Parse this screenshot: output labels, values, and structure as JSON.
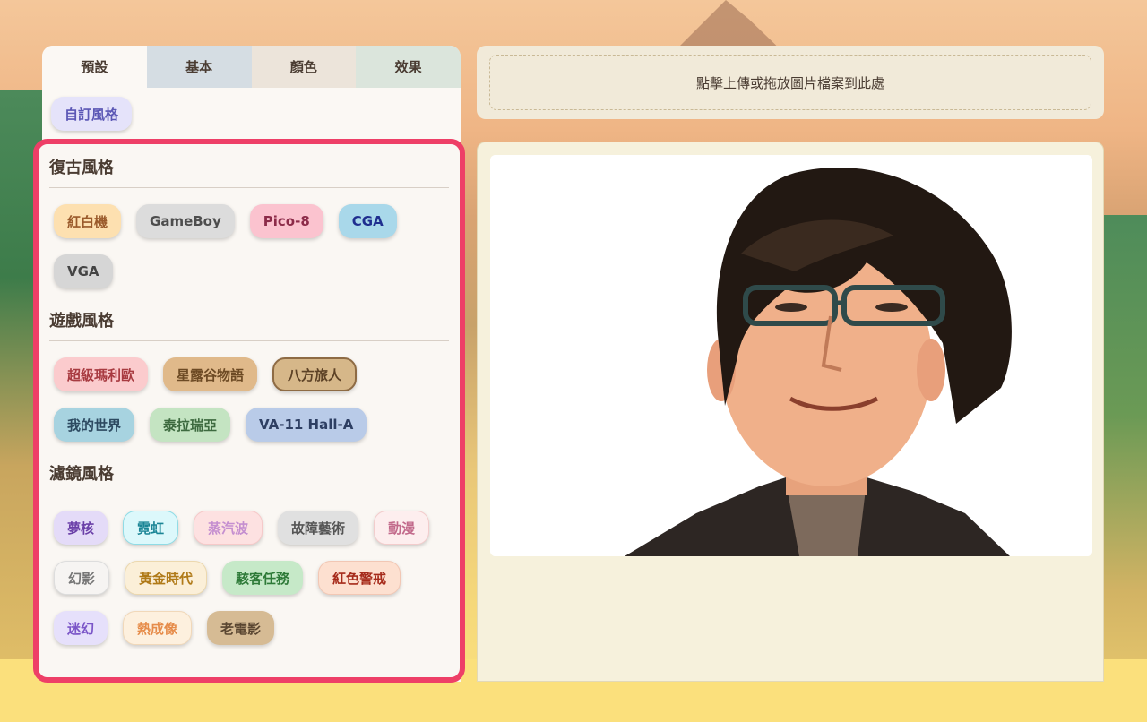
{
  "tabs": [
    {
      "label": "預設"
    },
    {
      "label": "基本"
    },
    {
      "label": "顏色"
    },
    {
      "label": "效果"
    }
  ],
  "custom_style": "自訂風格",
  "sections": [
    {
      "title": "復古風格",
      "chips": [
        "紅白機",
        "GameBoy",
        "Pico-8",
        "CGA",
        "VGA"
      ]
    },
    {
      "title": "遊戲風格",
      "chips": [
        "超級瑪利歐",
        "星露谷物語",
        "八方旅人",
        "我的世界",
        "泰拉瑞亞",
        "VA-11 Hall-A"
      ]
    },
    {
      "title": "濾鏡風格",
      "chips": [
        "夢核",
        "霓虹",
        "蒸汽波",
        "故障藝術",
        "動漫",
        "幻影",
        "黃金時代",
        "駭客任務",
        "紅色警戒",
        "迷幻",
        "熱成像",
        "老電影"
      ]
    }
  ],
  "upload_text": "點擊上傳或拖放圖片檔案到此處",
  "colors": {
    "highlight_border": "#ee3f67"
  }
}
